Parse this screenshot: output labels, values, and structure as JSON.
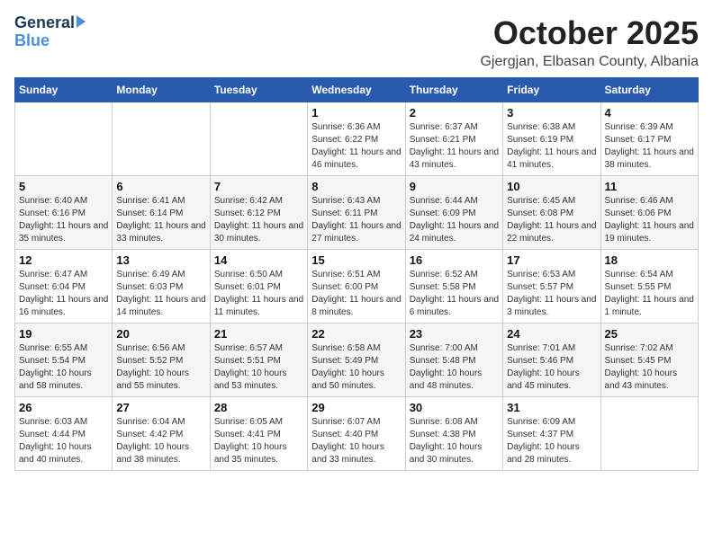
{
  "header": {
    "logo_line1": "General",
    "logo_line2": "Blue",
    "month_title": "October 2025",
    "location": "Gjergjan, Elbasan County, Albania"
  },
  "weekdays": [
    "Sunday",
    "Monday",
    "Tuesday",
    "Wednesday",
    "Thursday",
    "Friday",
    "Saturday"
  ],
  "weeks": [
    [
      {
        "day": "",
        "info": ""
      },
      {
        "day": "",
        "info": ""
      },
      {
        "day": "",
        "info": ""
      },
      {
        "day": "1",
        "info": "Sunrise: 6:36 AM\nSunset: 6:22 PM\nDaylight: 11 hours\nand 46 minutes."
      },
      {
        "day": "2",
        "info": "Sunrise: 6:37 AM\nSunset: 6:21 PM\nDaylight: 11 hours\nand 43 minutes."
      },
      {
        "day": "3",
        "info": "Sunrise: 6:38 AM\nSunset: 6:19 PM\nDaylight: 11 hours\nand 41 minutes."
      },
      {
        "day": "4",
        "info": "Sunrise: 6:39 AM\nSunset: 6:17 PM\nDaylight: 11 hours\nand 38 minutes."
      }
    ],
    [
      {
        "day": "5",
        "info": "Sunrise: 6:40 AM\nSunset: 6:16 PM\nDaylight: 11 hours\nand 35 minutes."
      },
      {
        "day": "6",
        "info": "Sunrise: 6:41 AM\nSunset: 6:14 PM\nDaylight: 11 hours\nand 33 minutes."
      },
      {
        "day": "7",
        "info": "Sunrise: 6:42 AM\nSunset: 6:12 PM\nDaylight: 11 hours\nand 30 minutes."
      },
      {
        "day": "8",
        "info": "Sunrise: 6:43 AM\nSunset: 6:11 PM\nDaylight: 11 hours\nand 27 minutes."
      },
      {
        "day": "9",
        "info": "Sunrise: 6:44 AM\nSunset: 6:09 PM\nDaylight: 11 hours\nand 24 minutes."
      },
      {
        "day": "10",
        "info": "Sunrise: 6:45 AM\nSunset: 6:08 PM\nDaylight: 11 hours\nand 22 minutes."
      },
      {
        "day": "11",
        "info": "Sunrise: 6:46 AM\nSunset: 6:06 PM\nDaylight: 11 hours\nand 19 minutes."
      }
    ],
    [
      {
        "day": "12",
        "info": "Sunrise: 6:47 AM\nSunset: 6:04 PM\nDaylight: 11 hours\nand 16 minutes."
      },
      {
        "day": "13",
        "info": "Sunrise: 6:49 AM\nSunset: 6:03 PM\nDaylight: 11 hours\nand 14 minutes."
      },
      {
        "day": "14",
        "info": "Sunrise: 6:50 AM\nSunset: 6:01 PM\nDaylight: 11 hours\nand 11 minutes."
      },
      {
        "day": "15",
        "info": "Sunrise: 6:51 AM\nSunset: 6:00 PM\nDaylight: 11 hours\nand 8 minutes."
      },
      {
        "day": "16",
        "info": "Sunrise: 6:52 AM\nSunset: 5:58 PM\nDaylight: 11 hours\nand 6 minutes."
      },
      {
        "day": "17",
        "info": "Sunrise: 6:53 AM\nSunset: 5:57 PM\nDaylight: 11 hours\nand 3 minutes."
      },
      {
        "day": "18",
        "info": "Sunrise: 6:54 AM\nSunset: 5:55 PM\nDaylight: 11 hours\nand 1 minute."
      }
    ],
    [
      {
        "day": "19",
        "info": "Sunrise: 6:55 AM\nSunset: 5:54 PM\nDaylight: 10 hours\nand 58 minutes."
      },
      {
        "day": "20",
        "info": "Sunrise: 6:56 AM\nSunset: 5:52 PM\nDaylight: 10 hours\nand 55 minutes."
      },
      {
        "day": "21",
        "info": "Sunrise: 6:57 AM\nSunset: 5:51 PM\nDaylight: 10 hours\nand 53 minutes."
      },
      {
        "day": "22",
        "info": "Sunrise: 6:58 AM\nSunset: 5:49 PM\nDaylight: 10 hours\nand 50 minutes."
      },
      {
        "day": "23",
        "info": "Sunrise: 7:00 AM\nSunset: 5:48 PM\nDaylight: 10 hours\nand 48 minutes."
      },
      {
        "day": "24",
        "info": "Sunrise: 7:01 AM\nSunset: 5:46 PM\nDaylight: 10 hours\nand 45 minutes."
      },
      {
        "day": "25",
        "info": "Sunrise: 7:02 AM\nSunset: 5:45 PM\nDaylight: 10 hours\nand 43 minutes."
      }
    ],
    [
      {
        "day": "26",
        "info": "Sunrise: 6:03 AM\nSunset: 4:44 PM\nDaylight: 10 hours\nand 40 minutes."
      },
      {
        "day": "27",
        "info": "Sunrise: 6:04 AM\nSunset: 4:42 PM\nDaylight: 10 hours\nand 38 minutes."
      },
      {
        "day": "28",
        "info": "Sunrise: 6:05 AM\nSunset: 4:41 PM\nDaylight: 10 hours\nand 35 minutes."
      },
      {
        "day": "29",
        "info": "Sunrise: 6:07 AM\nSunset: 4:40 PM\nDaylight: 10 hours\nand 33 minutes."
      },
      {
        "day": "30",
        "info": "Sunrise: 6:08 AM\nSunset: 4:38 PM\nDaylight: 10 hours\nand 30 minutes."
      },
      {
        "day": "31",
        "info": "Sunrise: 6:09 AM\nSunset: 4:37 PM\nDaylight: 10 hours\nand 28 minutes."
      },
      {
        "day": "",
        "info": ""
      }
    ]
  ]
}
